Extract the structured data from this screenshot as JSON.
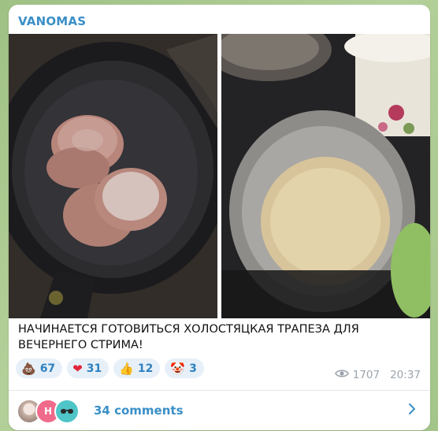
{
  "post": {
    "channel_name": "VANOMAS",
    "caption": "НАЧИНАЕТСЯ ГОТОВИТЬСЯ ХОЛОСТЯЦКАЯ ТРАПЕЗА ДЛЯ ВЕЧЕРНЕГО СТРИМА!",
    "views": "1707",
    "time": "20:37"
  },
  "reactions": [
    {
      "emoji": "💩",
      "count": "67"
    },
    {
      "emoji": "❤",
      "count": "31"
    },
    {
      "emoji": "👍",
      "count": "12"
    },
    {
      "emoji": "🤡",
      "count": "3"
    }
  ],
  "comments": {
    "label": "34 comments",
    "avatars": [
      "",
      "Н",
      ""
    ]
  },
  "colors": {
    "accent": "#3a8fc7",
    "reaction_bg": "#e7f0f8",
    "meta": "#9aa3ab",
    "chat_bg": "#a9c98f"
  },
  "icons": {
    "views": "eye-icon",
    "comments_arrow": "chevron-right-icon"
  }
}
